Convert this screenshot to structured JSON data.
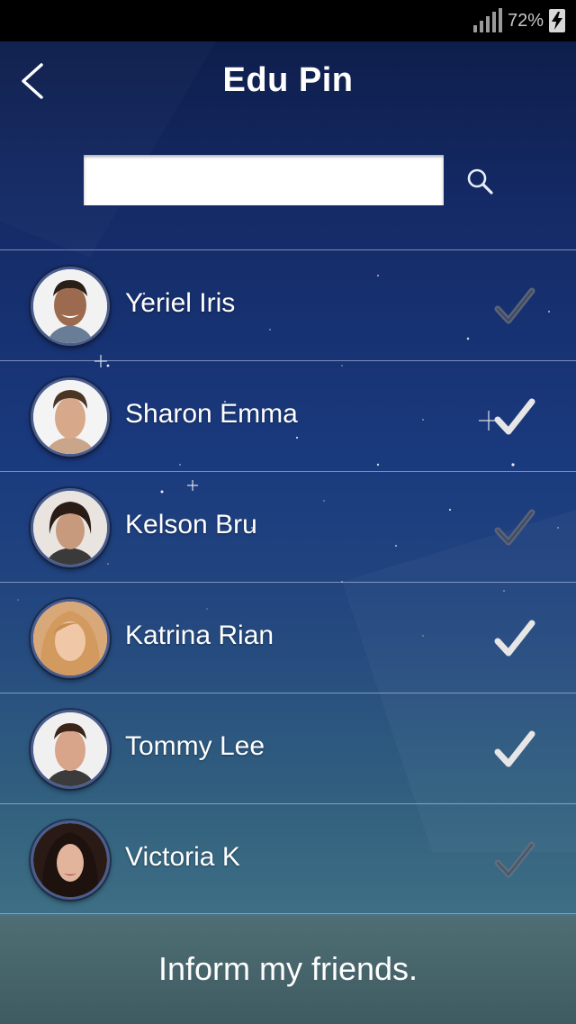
{
  "status_bar": {
    "battery_percent": "72%",
    "signal_icon": "signal-bars-icon",
    "battery_icon": "battery-charging-icon"
  },
  "header": {
    "title": "Edu Pin",
    "back_icon": "chevron-left-icon"
  },
  "search": {
    "value": "",
    "placeholder": "",
    "icon": "search-icon"
  },
  "friends": [
    {
      "name": "Yeriel Iris",
      "checked": false
    },
    {
      "name": "Sharon Emma",
      "checked": true
    },
    {
      "name": "Kelson Bru",
      "checked": false
    },
    {
      "name": "Katrina Rian",
      "checked": true
    },
    {
      "name": "Tommy Lee",
      "checked": true
    },
    {
      "name": "Victoria K",
      "checked": false
    }
  ],
  "footer": {
    "button_label": "Inform my friends."
  },
  "colors": {
    "background_top": "#0d1b45",
    "background_bottom": "#4b7d8c",
    "check_active": "#e6e6e6",
    "check_inactive": "#5a6478",
    "footer_bg": "#4e6e74"
  }
}
